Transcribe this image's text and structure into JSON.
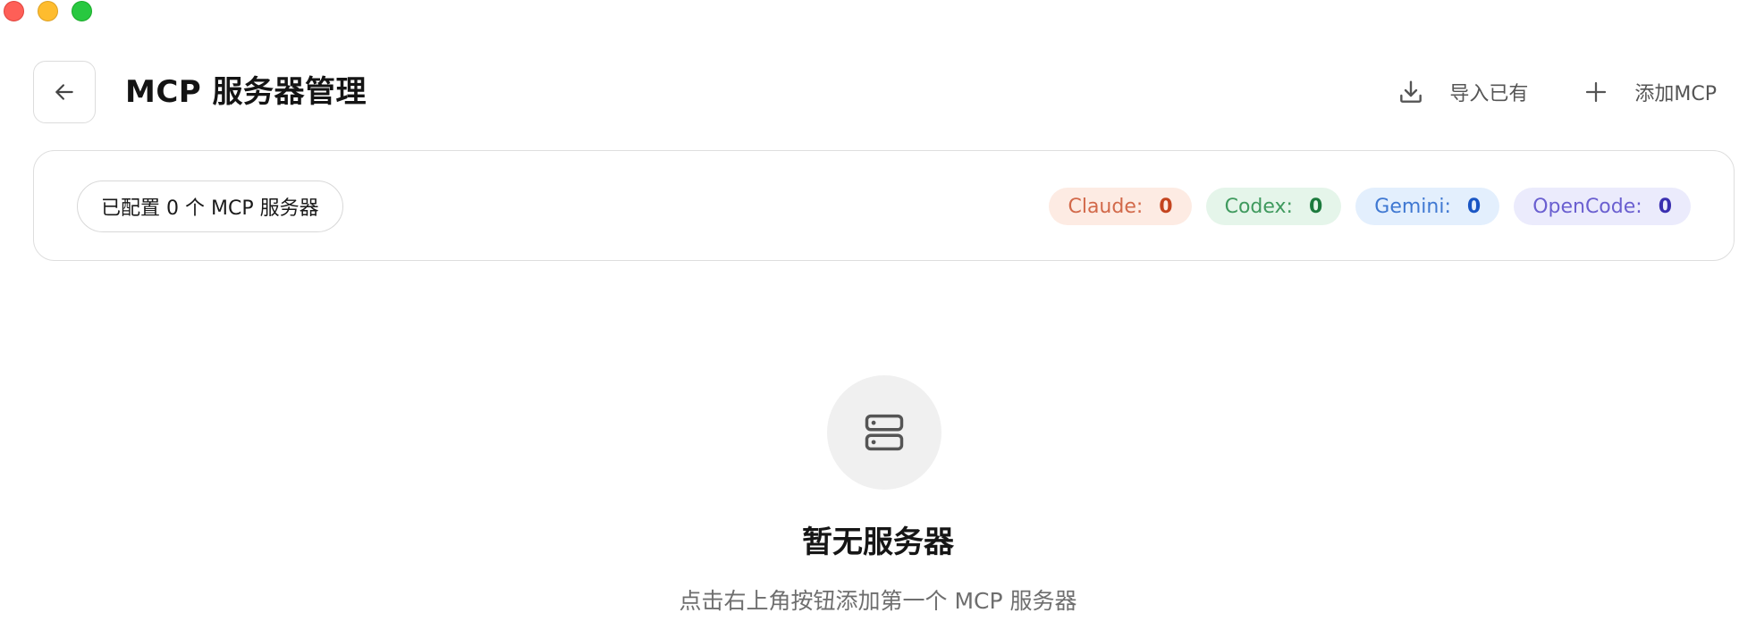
{
  "header": {
    "title": "MCP 服务器管理",
    "back_icon": "arrow-left-icon",
    "actions": {
      "import": {
        "label": "导入已有",
        "icon": "download-icon"
      },
      "add": {
        "label": "添加MCP",
        "icon": "plus-icon"
      }
    }
  },
  "summary": {
    "configured_label": "已配置 0 个 MCP 服务器",
    "apps": [
      {
        "name": "Claude:",
        "count": "0",
        "bg": "#fdebe3",
        "label_color": "#d2694a",
        "count_color": "#c4441f"
      },
      {
        "name": "Codex:",
        "count": "0",
        "bg": "#e5f5ea",
        "label_color": "#3f9a5e",
        "count_color": "#1c7a3d"
      },
      {
        "name": "Gemini:",
        "count": "0",
        "bg": "#e3effd",
        "label_color": "#3f78d2",
        "count_color": "#1a56c4"
      },
      {
        "name": "OpenCode:",
        "count": "0",
        "bg": "#ebebfc",
        "label_color": "#6a5fd0",
        "count_color": "#3a2fb0"
      }
    ]
  },
  "empty_state": {
    "icon": "server-icon",
    "title": "暂无服务器",
    "description": "点击右上角按钮添加第一个 MCP 服务器"
  },
  "colors": {
    "traffic_red": "#fe5f57",
    "traffic_yellow": "#febc2e",
    "traffic_green": "#28c840"
  }
}
